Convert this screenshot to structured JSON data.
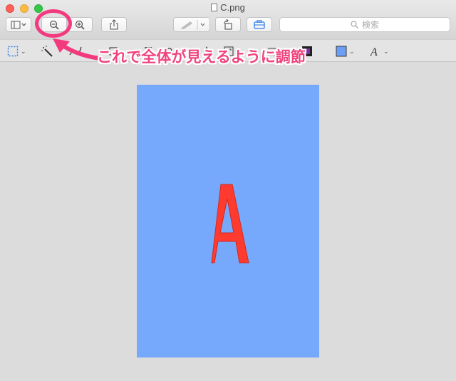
{
  "window": {
    "title": "C.png"
  },
  "toolbar": {
    "sidebar_icon": "sidebar-icon",
    "zoom_out_icon": "zoom-out-icon",
    "zoom_in_icon": "zoom-in-icon",
    "share_icon": "share-icon",
    "markup_pen_icon": "pen-icon",
    "rotate_icon": "rotate-icon",
    "toolbox_icon": "toolbox-icon",
    "search_placeholder": "検索"
  },
  "markup_tools": [
    "selection-icon",
    "magic-wand-icon",
    "sketch-icon",
    "shapes-icon",
    "text-icon",
    "sign-icon",
    "adjust-color-icon",
    "adjust-size-icon",
    "line-style-icon",
    "border-color-icon",
    "fill-color-icon",
    "font-style-icon"
  ],
  "document": {
    "letter": "A",
    "background": "#76a8fc",
    "letter_color": "#ff3b2f"
  },
  "annotation": {
    "text": "これで全体が見えるように調節",
    "color": "#f0437f"
  }
}
